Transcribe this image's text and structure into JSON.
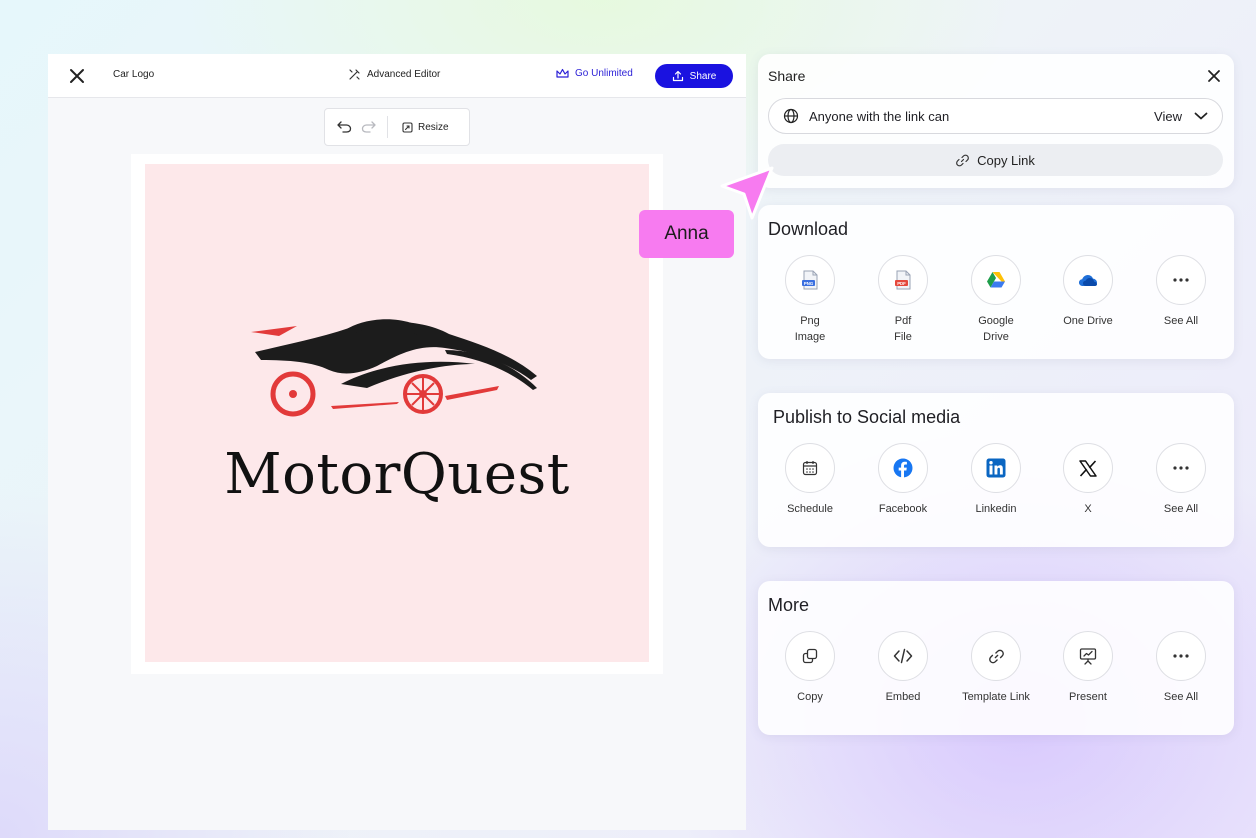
{
  "editor": {
    "doc_title": "Car Logo",
    "advanced_editor_label": "Advanced Editor",
    "go_unlimited_label": "Go Unlimited",
    "share_label": "Share",
    "resize_label": "Resize",
    "canvas": {
      "brand_text": "MotorQuest",
      "background_color": "#fde8ea"
    }
  },
  "share_panel": {
    "title": "Share",
    "access_text": "Anyone with the link can",
    "permission": "View",
    "copy_link_label": "Copy Link"
  },
  "download": {
    "title": "Download",
    "items": [
      {
        "label": "Png\nImage",
        "icon": "png-file-icon"
      },
      {
        "label": "Pdf\nFile",
        "icon": "pdf-file-icon"
      },
      {
        "label": "Google\nDrive",
        "icon": "google-drive-icon"
      },
      {
        "label": "One Drive",
        "icon": "onedrive-icon"
      },
      {
        "label": "See All",
        "icon": "more-icon"
      }
    ]
  },
  "social": {
    "title": "Publish to Social media",
    "items": [
      {
        "label": "Schedule",
        "icon": "calendar-icon"
      },
      {
        "label": "Facebook",
        "icon": "facebook-icon"
      },
      {
        "label": "Linkedin",
        "icon": "linkedin-icon"
      },
      {
        "label": "X",
        "icon": "x-icon"
      },
      {
        "label": "See All",
        "icon": "more-icon"
      }
    ]
  },
  "more": {
    "title": "More",
    "items": [
      {
        "label": "Copy",
        "icon": "copy-icon"
      },
      {
        "label": "Embed",
        "icon": "code-icon"
      },
      {
        "label": "Template Link",
        "icon": "link-icon"
      },
      {
        "label": "Present",
        "icon": "present-icon"
      },
      {
        "label": "See All",
        "icon": "more-icon"
      }
    ]
  },
  "collaborator": {
    "name": "Anna",
    "color": "#f77bf0"
  },
  "colors": {
    "primary": "#1a12e0",
    "accent_red": "#e23a3a"
  }
}
